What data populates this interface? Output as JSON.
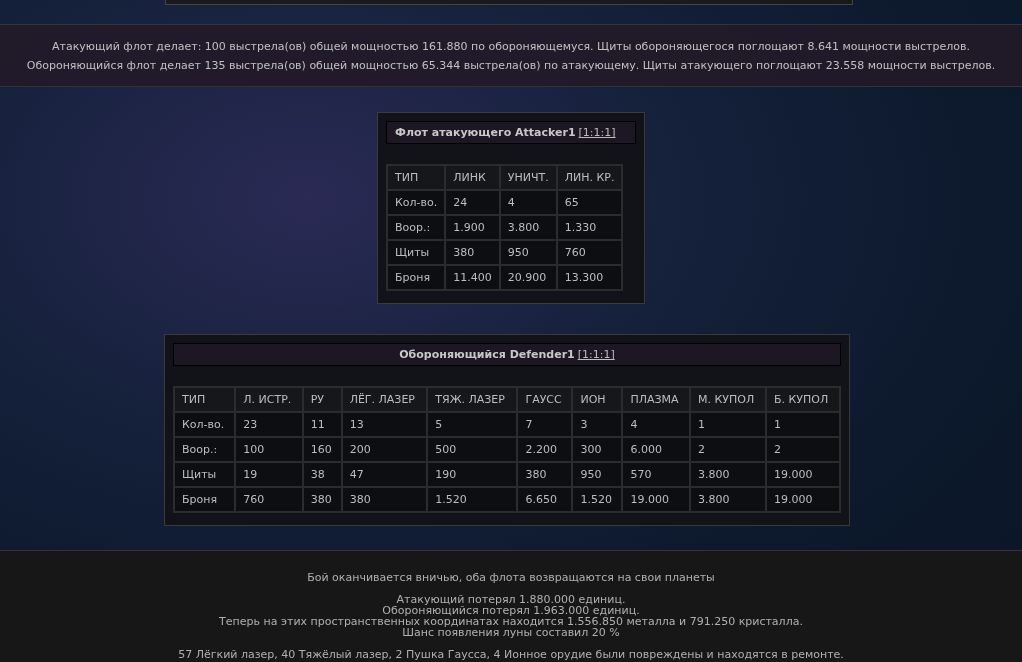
{
  "round_summary": [
    "Атакующий флот делает: 100 выстрела(ов) общей мощностью 161.880 по обороняющемуся. Щиты обороняющегося поглощают 8.641 мощности выстрелов.",
    "Обороняющийся флот делает 135 выстрела(ов) общей мощностью 65.344 выстрела(ов) по атакующему. Щиты атакующего поглощают 23.558 мощности выстрелов."
  ],
  "fleets": [
    {
      "title": "Флот атакующего Attacker1",
      "coords": "[1:1:1]",
      "columns": [
        "ТИП",
        "ЛИНК",
        "УНИЧТ.",
        "ЛИН. КР."
      ],
      "rows": [
        {
          "label": "Кол-во.",
          "values": [
            "24",
            "4",
            "65"
          ]
        },
        {
          "label": "Воор.:",
          "values": [
            "1.900",
            "3.800",
            "1.330"
          ]
        },
        {
          "label": "Щиты",
          "values": [
            "380",
            "950",
            "760"
          ]
        },
        {
          "label": "Броня",
          "values": [
            "11.400",
            "20.900",
            "13.300"
          ]
        }
      ]
    },
    {
      "title": "Обороняющийся Defender1",
      "coords": "[1:1:1]",
      "columns": [
        "ТИП",
        "Л. ИСТР.",
        "РУ",
        "ЛЁГ. ЛАЗЕР",
        "ТЯЖ. ЛАЗЕР",
        "ГАУСС",
        "ИОН",
        "ПЛАЗМА",
        "М. КУПОЛ",
        "Б. КУПОЛ"
      ],
      "rows": [
        {
          "label": "Кол-во.",
          "values": [
            "23",
            "11",
            "13",
            "5",
            "7",
            "3",
            "4",
            "1",
            "1"
          ]
        },
        {
          "label": "Воор.:",
          "values": [
            "100",
            "160",
            "200",
            "500",
            "2.200",
            "300",
            "6.000",
            "2",
            "2"
          ]
        },
        {
          "label": "Щиты",
          "values": [
            "19",
            "38",
            "47",
            "190",
            "380",
            "950",
            "570",
            "3.800",
            "19.000"
          ]
        },
        {
          "label": "Броня",
          "values": [
            "760",
            "380",
            "380",
            "1.520",
            "6.650",
            "1.520",
            "19.000",
            "3.800",
            "19.000"
          ]
        }
      ]
    }
  ],
  "result": {
    "outcome": "Бой оканчивается вничью, оба флота возвращаются на свои планеты",
    "stats": [
      "Атакующий потерял 1.880.000 единиц.",
      "Обороняющийся потерял 1.963.000 единиц.",
      "Теперь на этих пространственных координатах находится 1.556.850 металла и 791.250 кристалла.",
      "Шанс появления луны составил 20 %"
    ],
    "repairs": "57 Лёгкий лазер, 40 Тяжёлый лазер, 2 Пушка Гаусса, 4 Ионное орудие были повреждены и находятся в ремонте."
  }
}
